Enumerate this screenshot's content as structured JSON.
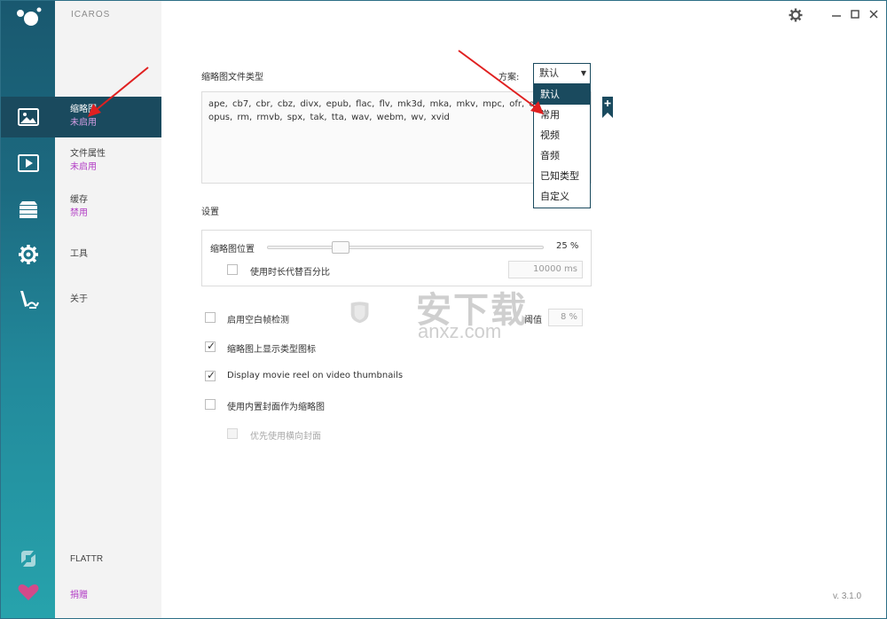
{
  "app": {
    "title": "ICAROS",
    "version": "v. 3.1.0"
  },
  "rail": [
    {
      "icon": "image-icon",
      "active": true
    },
    {
      "icon": "play-icon",
      "active": false
    },
    {
      "icon": "stack-icon",
      "active": false
    },
    {
      "icon": "gear-icon",
      "active": false
    },
    {
      "icon": "tools-icon",
      "active": false
    }
  ],
  "nav": {
    "items": [
      {
        "label": "缩略图",
        "status": "未启用"
      },
      {
        "label": "文件属性",
        "status": "未启用"
      },
      {
        "label": "缓存",
        "status": "禁用"
      },
      {
        "label": "工具",
        "status": ""
      },
      {
        "label": "关于",
        "status": ""
      }
    ],
    "flattr": "FLATTR",
    "donate": "捐赠"
  },
  "main": {
    "types_title": "缩略图文件类型",
    "types_text": "ape, cb7, cbr, cbz, divx, epub, flac, flv, mk3d, mka, mkv, mpc, ofr, ogm, ogv, opus, rm, rmvb, spx, tak, tta, wav, webm, wv, xvid",
    "scheme_label": "方案:",
    "scheme_value": "默认",
    "scheme_options": [
      "默认",
      "常用",
      "视频",
      "音频",
      "已知类型",
      "自定义"
    ],
    "settings_title": "设置",
    "thumb_position_label": "缩略图位置",
    "thumb_position_value": "25 %",
    "thumb_position_fraction": 0.25,
    "use_duration_label": "使用时长代替百分比",
    "duration_value": "10000 ms",
    "blank_detect_label": "启用空白帧检测",
    "threshold_label": "阈值",
    "threshold_value": "8 %",
    "show_type_icon_label": "缩略图上显示类型图标",
    "movie_reel_label": "Display movie reel on video thumbnails",
    "use_cover_label": "使用内置封面作为缩略图",
    "prefer_landscape_label": "优先使用横向封面"
  },
  "watermark": {
    "cn": "安下载",
    "en": "anxz.com"
  },
  "colors": {
    "accent": "#1a4a5e",
    "status": "#b23cc5",
    "rail_top": "#19586f",
    "rail_bottom": "#27a3ac"
  }
}
